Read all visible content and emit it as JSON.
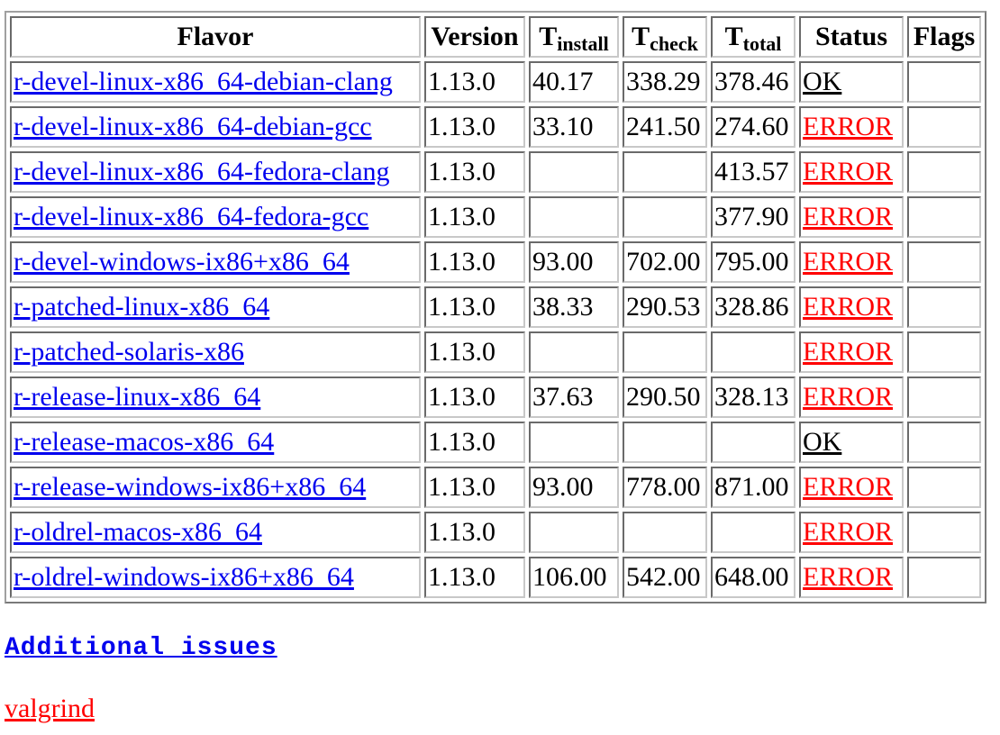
{
  "table": {
    "headers": {
      "flavor": "Flavor",
      "version": "Version",
      "t_install": {
        "main": "T",
        "sub": "install"
      },
      "t_check": {
        "main": "T",
        "sub": "check"
      },
      "t_total": {
        "main": "T",
        "sub": "total"
      },
      "status": "Status",
      "flags": "Flags"
    },
    "rows": [
      {
        "flavor": "r-devel-linux-x86_64-debian-clang",
        "version": "1.13.0",
        "t_install": "40.17",
        "t_check": "338.29",
        "t_total": "378.46",
        "status": "OK",
        "flags": ""
      },
      {
        "flavor": "r-devel-linux-x86_64-debian-gcc",
        "version": "1.13.0",
        "t_install": "33.10",
        "t_check": "241.50",
        "t_total": "274.60",
        "status": "ERROR",
        "flags": ""
      },
      {
        "flavor": "r-devel-linux-x86_64-fedora-clang",
        "version": "1.13.0",
        "t_install": "",
        "t_check": "",
        "t_total": "413.57",
        "status": "ERROR",
        "flags": ""
      },
      {
        "flavor": "r-devel-linux-x86_64-fedora-gcc",
        "version": "1.13.0",
        "t_install": "",
        "t_check": "",
        "t_total": "377.90",
        "status": "ERROR",
        "flags": ""
      },
      {
        "flavor": "r-devel-windows-ix86+x86_64",
        "version": "1.13.0",
        "t_install": "93.00",
        "t_check": "702.00",
        "t_total": "795.00",
        "status": "ERROR",
        "flags": ""
      },
      {
        "flavor": "r-patched-linux-x86_64",
        "version": "1.13.0",
        "t_install": "38.33",
        "t_check": "290.53",
        "t_total": "328.86",
        "status": "ERROR",
        "flags": ""
      },
      {
        "flavor": "r-patched-solaris-x86",
        "version": "1.13.0",
        "t_install": "",
        "t_check": "",
        "t_total": "",
        "status": "ERROR",
        "flags": ""
      },
      {
        "flavor": "r-release-linux-x86_64",
        "version": "1.13.0",
        "t_install": "37.63",
        "t_check": "290.50",
        "t_total": "328.13",
        "status": "ERROR",
        "flags": ""
      },
      {
        "flavor": "r-release-macos-x86_64",
        "version": "1.13.0",
        "t_install": "",
        "t_check": "",
        "t_total": "",
        "status": "OK",
        "flags": ""
      },
      {
        "flavor": "r-release-windows-ix86+x86_64",
        "version": "1.13.0",
        "t_install": "93.00",
        "t_check": "778.00",
        "t_total": "871.00",
        "status": "ERROR",
        "flags": ""
      },
      {
        "flavor": "r-oldrel-macos-x86_64",
        "version": "1.13.0",
        "t_install": "",
        "t_check": "",
        "t_total": "",
        "status": "ERROR",
        "flags": ""
      },
      {
        "flavor": "r-oldrel-windows-ix86+x86_64",
        "version": "1.13.0",
        "t_install": "106.00",
        "t_check": "542.00",
        "t_total": "648.00",
        "status": "ERROR",
        "flags": ""
      }
    ]
  },
  "additional_issues": {
    "heading": "Additional issues",
    "items": [
      "valgrind"
    ]
  },
  "colors": {
    "link": "#0000ee",
    "error": "#ff0000",
    "ok": "#000000"
  }
}
